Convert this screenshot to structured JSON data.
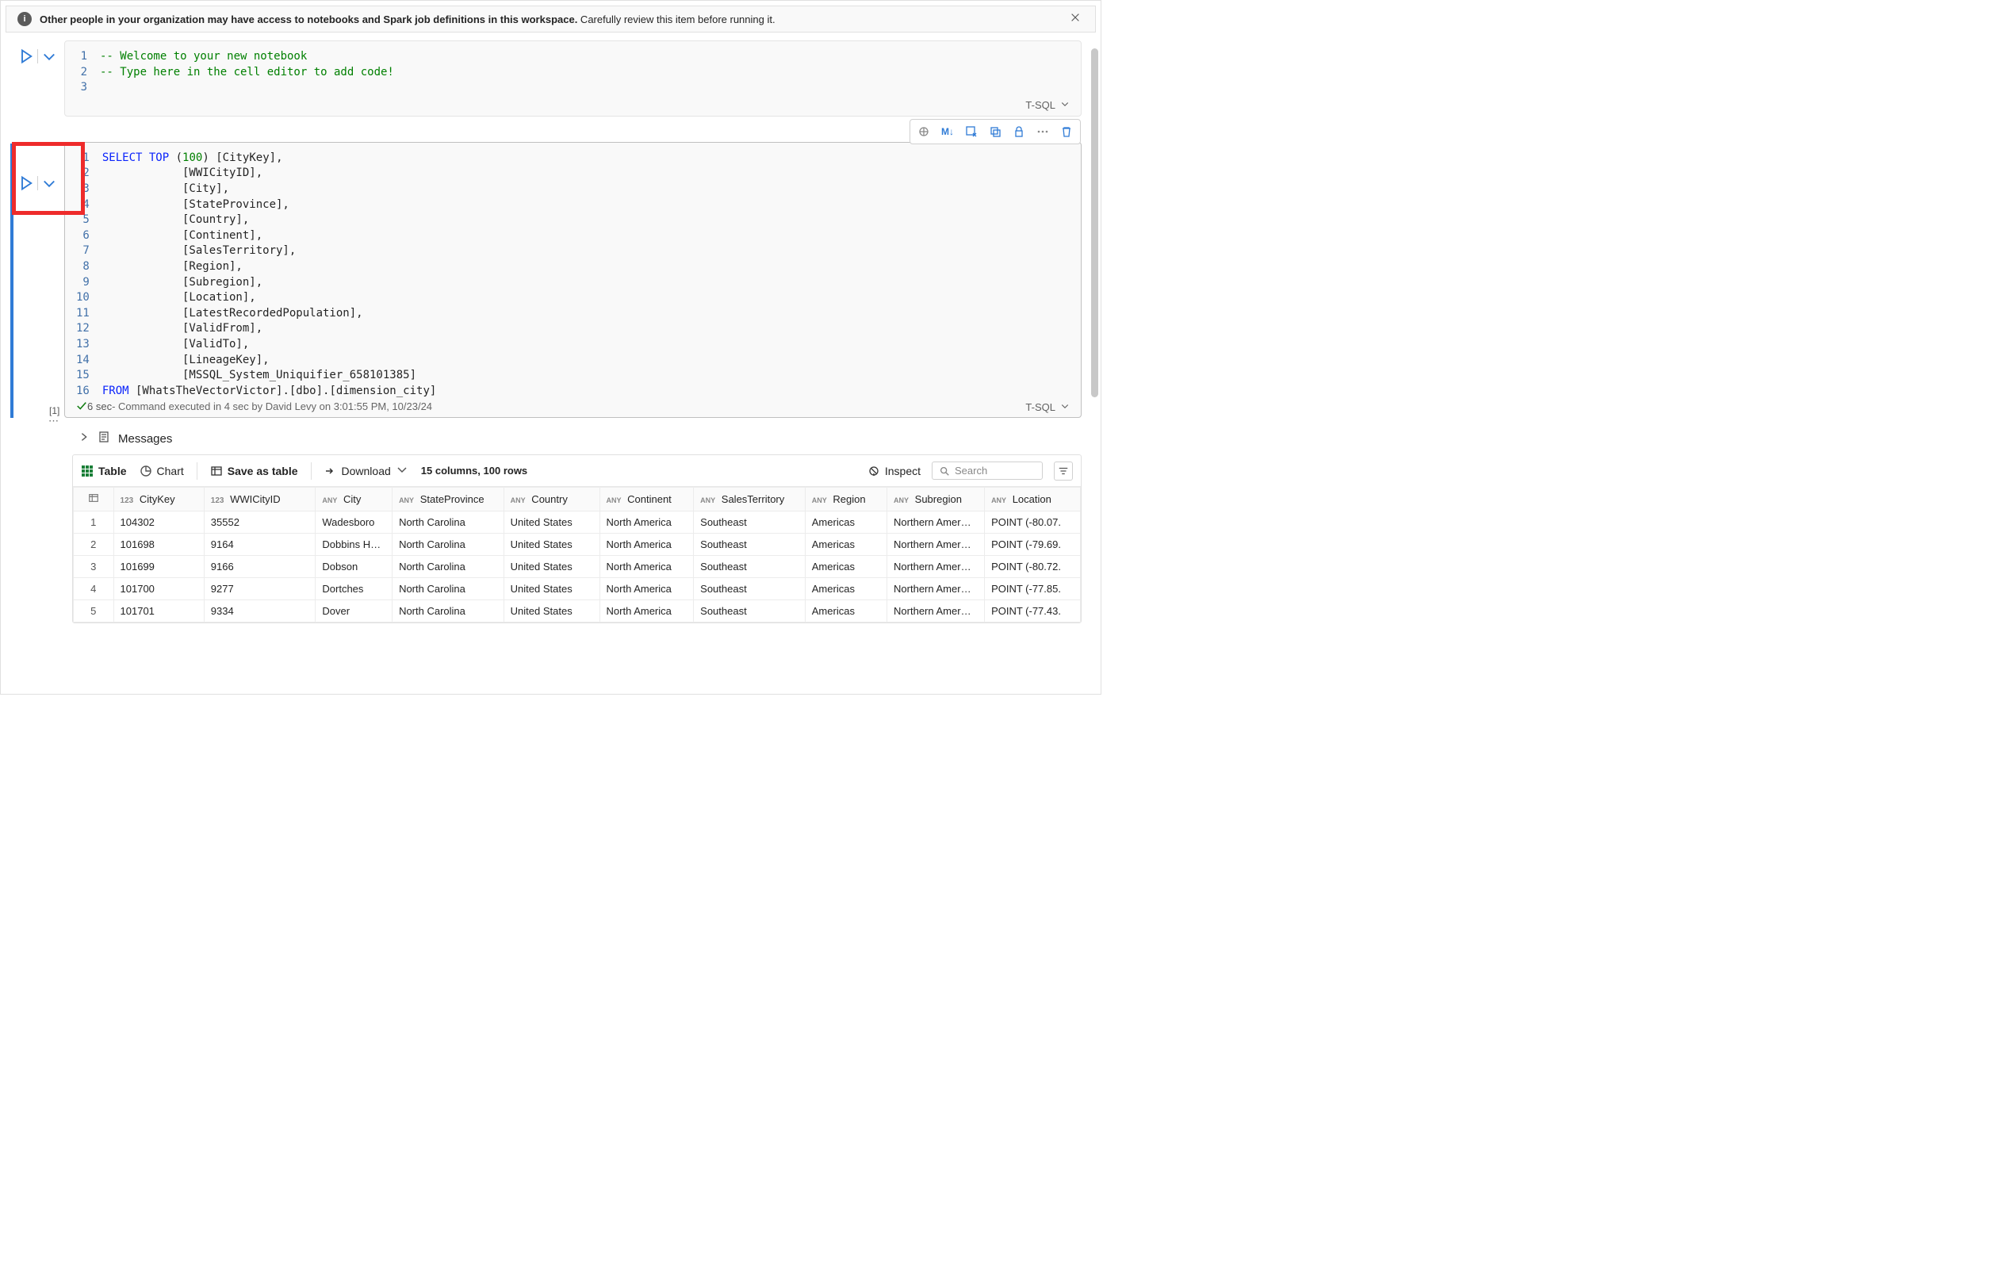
{
  "banner": {
    "bold": "Other people in your organization may have access to notebooks and Spark job definitions in this workspace.",
    "rest": " Carefully review this item before running it."
  },
  "cell1": {
    "code": [
      {
        "n": "1",
        "html": "<span class='tok-comment'>-- Welcome to your new notebook</span>"
      },
      {
        "n": "2",
        "html": "<span class='tok-comment'>-- Type here in the cell editor to add code!</span>"
      },
      {
        "n": "3",
        "html": ""
      }
    ],
    "lang": "T-SQL"
  },
  "cell2": {
    "code": [
      {
        "n": "1",
        "html": "<span class='tok-kw'>SELECT</span> <span class='tok-kw'>TOP</span> <span class='tok-br'>(</span><span class='tok-num'>100</span><span class='tok-br'>)</span> [CityKey],"
      },
      {
        "n": "2",
        "html": "            [WWICityID],"
      },
      {
        "n": "3",
        "html": "            [City],"
      },
      {
        "n": "4",
        "html": "            [StateProvince],"
      },
      {
        "n": "5",
        "html": "            [Country],"
      },
      {
        "n": "6",
        "html": "            [Continent],"
      },
      {
        "n": "7",
        "html": "            [SalesTerritory],"
      },
      {
        "n": "8",
        "html": "            [Region],"
      },
      {
        "n": "9",
        "html": "            [Subregion],"
      },
      {
        "n": "10",
        "html": "            [Location],"
      },
      {
        "n": "11",
        "html": "            [LatestRecordedPopulation],"
      },
      {
        "n": "12",
        "html": "            [ValidFrom],"
      },
      {
        "n": "13",
        "html": "            [ValidTo],"
      },
      {
        "n": "14",
        "html": "            [LineageKey],"
      },
      {
        "n": "15",
        "html": "            [MSSQL_System_Uniquifier_658101385]"
      },
      {
        "n": "16",
        "html": "<span class='tok-kw'>FROM</span> [WhatsTheVectorVictor].[dbo].[dimension_city]"
      }
    ],
    "exec_counter": "[1]",
    "exec_duration": "6 sec",
    "exec_detail": " - Command executed in 4 sec by David Levy on 3:01:55 PM, 10/23/24",
    "lang": "T-SQL",
    "toolbar_md": "M↓"
  },
  "output": {
    "messages_label": "Messages",
    "views": {
      "table": "Table",
      "chart": "Chart"
    },
    "save_table": "Save as table",
    "download": "Download",
    "summary": "15 columns, 100 rows",
    "inspect": "Inspect",
    "search_placeholder": "Search",
    "columns": [
      {
        "type": "123",
        "label": "CityKey",
        "cls": "col-cw"
      },
      {
        "type": "123",
        "label": "WWICityID",
        "cls": "col-ww"
      },
      {
        "type": "ANY",
        "label": "City",
        "cls": "col-city"
      },
      {
        "type": "ANY",
        "label": "StateProvince",
        "cls": "col-sp"
      },
      {
        "type": "ANY",
        "label": "Country",
        "cls": "col-co"
      },
      {
        "type": "ANY",
        "label": "Continent",
        "cls": "col-cont"
      },
      {
        "type": "ANY",
        "label": "SalesTerritory",
        "cls": "col-st"
      },
      {
        "type": "ANY",
        "label": "Region",
        "cls": "col-reg"
      },
      {
        "type": "ANY",
        "label": "Subregion",
        "cls": "col-sub"
      },
      {
        "type": "ANY",
        "label": "Location",
        "cls": "col-loc"
      }
    ],
    "rows": [
      {
        "idx": "1",
        "cells": [
          "104302",
          "35552",
          "Wadesboro",
          "North Carolina",
          "United States",
          "North America",
          "Southeast",
          "Americas",
          "Northern Amer…",
          "POINT (-80.07."
        ]
      },
      {
        "idx": "2",
        "cells": [
          "101698",
          "9164",
          "Dobbins H…",
          "North Carolina",
          "United States",
          "North America",
          "Southeast",
          "Americas",
          "Northern Amer…",
          "POINT (-79.69."
        ]
      },
      {
        "idx": "3",
        "cells": [
          "101699",
          "9166",
          "Dobson",
          "North Carolina",
          "United States",
          "North America",
          "Southeast",
          "Americas",
          "Northern Amer…",
          "POINT (-80.72."
        ]
      },
      {
        "idx": "4",
        "cells": [
          "101700",
          "9277",
          "Dortches",
          "North Carolina",
          "United States",
          "North America",
          "Southeast",
          "Americas",
          "Northern Amer…",
          "POINT (-77.85."
        ]
      },
      {
        "idx": "5",
        "cells": [
          "101701",
          "9334",
          "Dover",
          "North Carolina",
          "United States",
          "North America",
          "Southeast",
          "Americas",
          "Northern Amer…",
          "POINT (-77.43."
        ]
      }
    ]
  }
}
